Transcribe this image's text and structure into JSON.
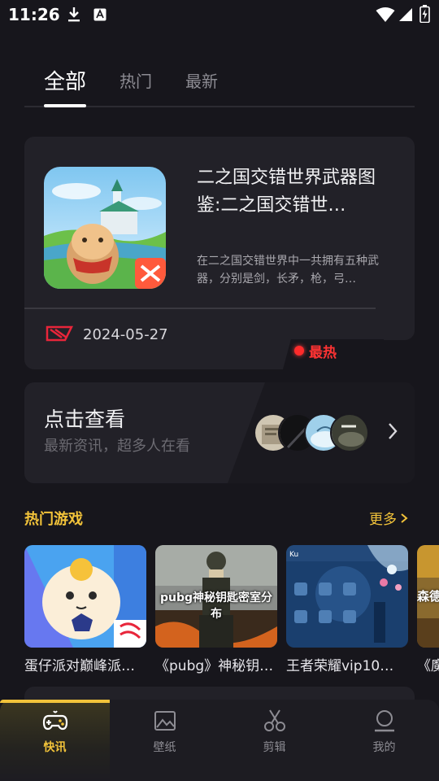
{
  "status_bar": {
    "time": "11:26"
  },
  "tabs": [
    {
      "label": "全部"
    },
    {
      "label": "热门"
    },
    {
      "label": "最新"
    }
  ],
  "featured": {
    "title": "二之国交错世界武器图鉴:二之国交错世…",
    "description": "在二之国交错世界中一共拥有五种武器，分别是剑，长矛，枪，弓…",
    "date": "2024-05-27",
    "badge": "最热"
  },
  "view_card": {
    "title": "点击查看",
    "subtitle": "最新资讯，超多人在看"
  },
  "hot_games": {
    "title": "热门游戏",
    "more_label": "更多",
    "items": [
      {
        "name": "蛋仔派对巅峰派对…"
      },
      {
        "name": "《pubg》神秘钥匙…",
        "overlay": "pubg神秘钥匙密室分布"
      },
      {
        "name": "王者荣耀vip10…"
      },
      {
        "name": "《魔",
        "overlay": "森德"
      }
    ]
  },
  "bottom_nav": [
    {
      "label": "快讯",
      "icon": "gamepad-icon",
      "active": true
    },
    {
      "label": "壁纸",
      "icon": "image-icon",
      "active": false
    },
    {
      "label": "剪辑",
      "icon": "scissors-icon",
      "active": false
    },
    {
      "label": "我的",
      "icon": "user-icon",
      "active": false
    }
  ],
  "colors": {
    "accent": "#f2c33a",
    "hot": "#ff3333",
    "background": "#17161c",
    "card": "#222128"
  }
}
